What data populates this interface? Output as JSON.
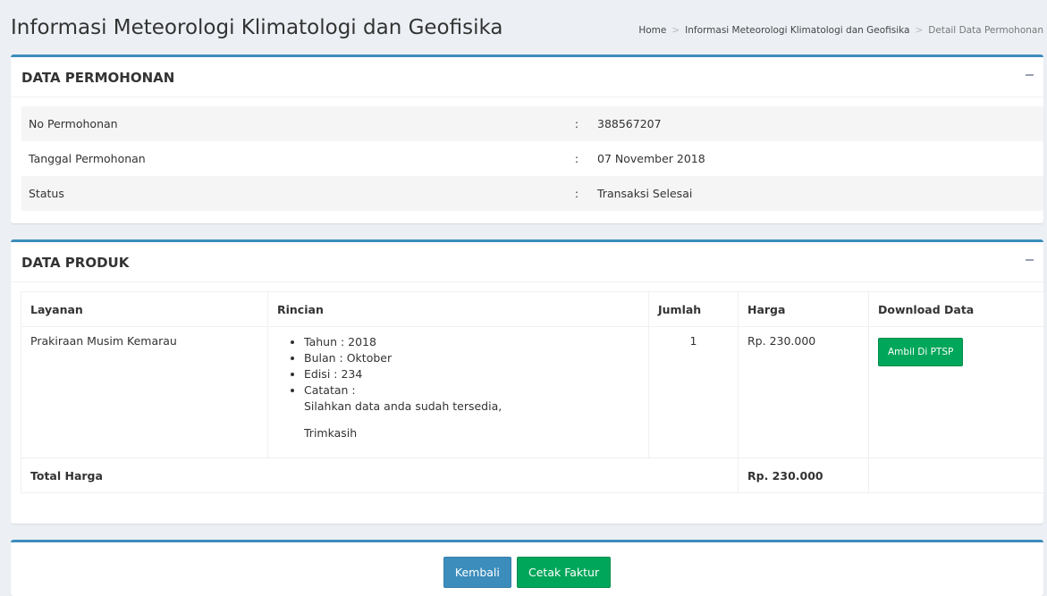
{
  "page": {
    "title": "Informasi Meteorologi Klimatologi dan Geofisika"
  },
  "breadcrumb": {
    "items": [
      "Home",
      "Informasi Meteorologi Klimatologi dan Geofisika",
      "Detail Data Permohonan"
    ]
  },
  "permohonan": {
    "title": "DATA PERMOHONAN",
    "rows": [
      {
        "label": "No Permohonan",
        "sep": ":",
        "value": "388567207"
      },
      {
        "label": "Tanggal Permohonan",
        "sep": ":",
        "value": "07 November 2018"
      },
      {
        "label": "Status",
        "sep": ":",
        "value": "Transaksi Selesai"
      }
    ]
  },
  "produk": {
    "title": "DATA PRODUK",
    "headers": [
      "Layanan",
      "Rincian",
      "Jumlah",
      "Harga",
      "Download Data"
    ],
    "row": {
      "layanan": "Prakiraan Musim Kemarau",
      "rincian": [
        "Tahun : 2018",
        "Bulan : Oktober",
        "Edisi : 234",
        "Catatan :"
      ],
      "catatan_line1": "Silahkan data anda sudah tersedia,",
      "catatan_line2": "Trimkasih",
      "jumlah": "1",
      "harga": "Rp. 230.000",
      "download_label": "Ambil Di PTSP"
    },
    "total_label": "Total Harga",
    "total_value": "Rp. 230.000"
  },
  "actions": {
    "back_label": "Kembali",
    "print_label": "Cetak Faktur"
  },
  "colors": {
    "accent": "#3c8dbc",
    "success": "#00a65a",
    "background": "#ecf0f5"
  }
}
